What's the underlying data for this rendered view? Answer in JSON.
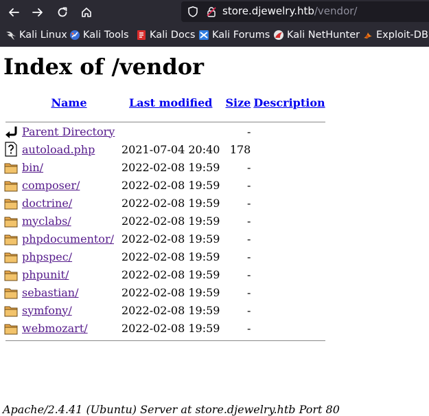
{
  "browser": {
    "url_host": "store.djewelry.htb",
    "url_path": "/vendor/",
    "bookmarks": [
      {
        "label": "Kali Linux",
        "icon": "kali-dragon-icon"
      },
      {
        "label": "Kali Tools",
        "icon": "kali-tools-icon"
      },
      {
        "label": "Kali Docs",
        "icon": "kali-docs-icon"
      },
      {
        "label": "Kali Forums",
        "icon": "kali-forums-icon"
      },
      {
        "label": "Kali NetHunter",
        "icon": "nethunter-icon"
      },
      {
        "label": "Exploit-DB",
        "icon": "exploit-db-icon"
      }
    ]
  },
  "page": {
    "title": "Index of /vendor",
    "headers": {
      "name": "Name",
      "modified": "Last modified",
      "size": "Size",
      "description": "Description"
    },
    "parent": {
      "name": "Parent Directory",
      "size": "-"
    },
    "rows": [
      {
        "name": "autoload.php",
        "modified": "2021-07-04 20:40",
        "size": "178",
        "icon": "file-unknown-icon"
      },
      {
        "name": "bin/",
        "modified": "2022-02-08 19:59",
        "size": "-",
        "icon": "folder-icon"
      },
      {
        "name": "composer/",
        "modified": "2022-02-08 19:59",
        "size": "-",
        "icon": "folder-icon"
      },
      {
        "name": "doctrine/",
        "modified": "2022-02-08 19:59",
        "size": "-",
        "icon": "folder-icon"
      },
      {
        "name": "myclabs/",
        "modified": "2022-02-08 19:59",
        "size": "-",
        "icon": "folder-icon"
      },
      {
        "name": "phpdocumentor/",
        "modified": "2022-02-08 19:59",
        "size": "-",
        "icon": "folder-icon"
      },
      {
        "name": "phpspec/",
        "modified": "2022-02-08 19:59",
        "size": "-",
        "icon": "folder-icon"
      },
      {
        "name": "phpunit/",
        "modified": "2022-02-08 19:59",
        "size": "-",
        "icon": "folder-icon"
      },
      {
        "name": "sebastian/",
        "modified": "2022-02-08 19:59",
        "size": "-",
        "icon": "folder-icon"
      },
      {
        "name": "symfony/",
        "modified": "2022-02-08 19:59",
        "size": "-",
        "icon": "folder-icon"
      },
      {
        "name": "webmozart/",
        "modified": "2022-02-08 19:59",
        "size": "-",
        "icon": "folder-icon"
      }
    ],
    "footer": "Apache/2.4.41 (Ubuntu) Server at store.djewelry.htb Port 80"
  },
  "colors": {
    "chrome_bg": "#2b2a33",
    "urlbar_bg": "#1c1b22",
    "link": "#0000ee",
    "visited_link": "#551a8b"
  }
}
